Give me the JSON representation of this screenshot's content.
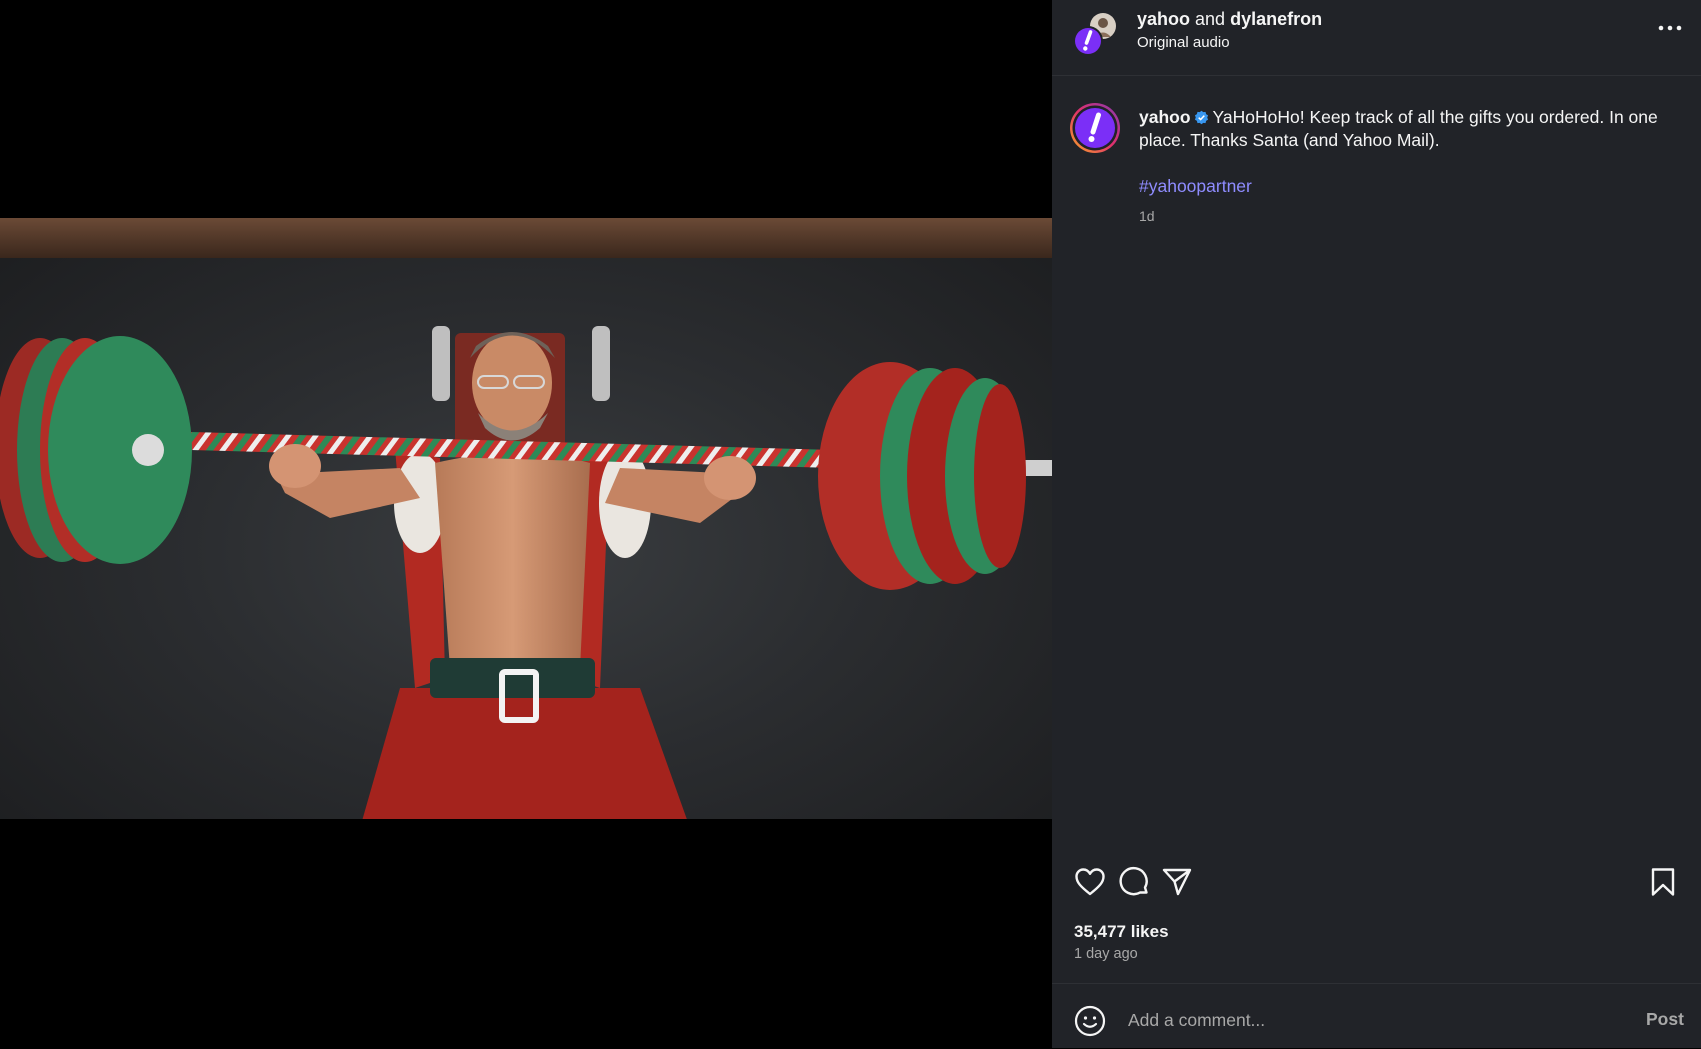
{
  "header": {
    "user1": "yahoo",
    "joiner": "and",
    "user2": "dylanefron",
    "subtitle": "Original audio",
    "more_icon": "more-horizontal-icon"
  },
  "caption": {
    "username": "yahoo",
    "text": "YaHoHoHo! Keep track of all the gifts you ordered. In one place. Thanks Santa (and Yahoo Mail).",
    "hashtag": "#yahoopartner",
    "time": "1d"
  },
  "actions": {
    "like_icon": "heart-icon",
    "comment_icon": "comment-icon",
    "share_icon": "share-icon",
    "save_icon": "bookmark-icon"
  },
  "stats": {
    "likes": "35,477 likes",
    "posted": "1 day ago"
  },
  "comment": {
    "placeholder": "Add a comment...",
    "post_label": "Post"
  },
  "colors": {
    "panel_bg": "#212328",
    "link": "#8f8cff",
    "brand_purple": "#7b2ff7",
    "verified": "#3897f0"
  }
}
